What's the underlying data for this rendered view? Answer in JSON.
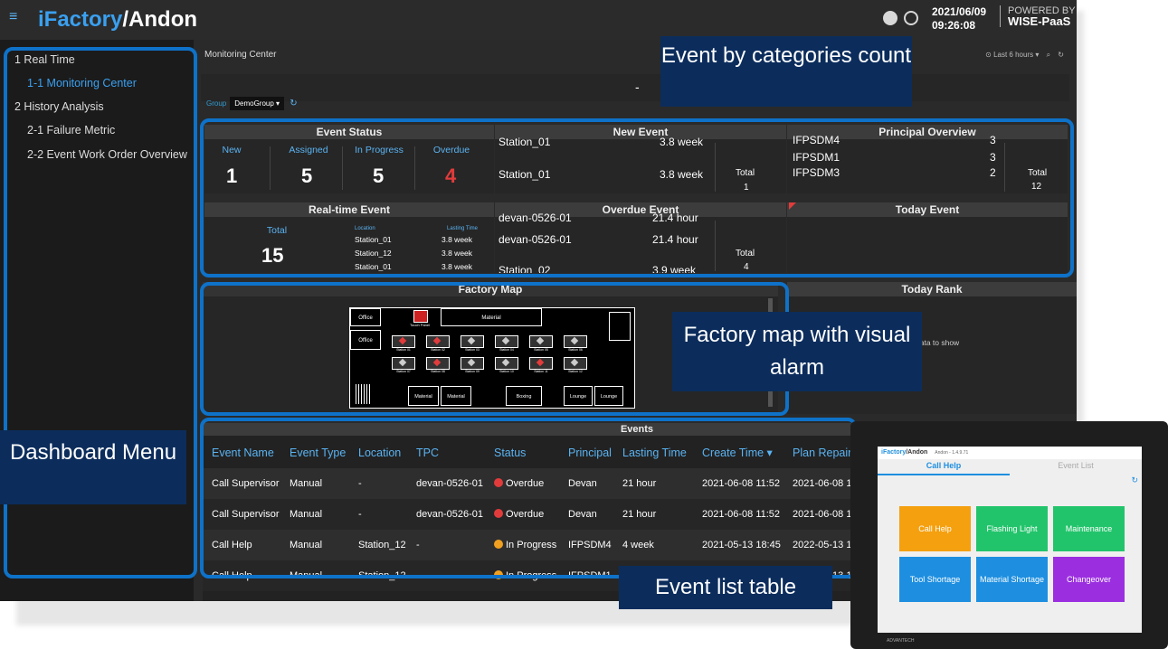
{
  "app": {
    "title_a": "iFactory",
    "title_b": "/Andon",
    "date": "2021/06/09",
    "time": "09:26:08",
    "powered_top": "POWERED BY",
    "powered_bottom": "WISE-PaaS"
  },
  "menu": [
    {
      "label": "1 Real Time"
    },
    {
      "label": "1-1 Monitoring Center",
      "active": true
    },
    {
      "label": "2 History Analysis"
    },
    {
      "label": "2-1 Failure Metric"
    },
    {
      "label": "2-2 Event Work Order Overview"
    }
  ],
  "breadcrumb": "Monitoring Center",
  "toolbar": {
    "time_range": "⊙ Last 6 hours ▾"
  },
  "banner_text": "-",
  "group": {
    "label": "Group",
    "value": "DemoGroup ▾"
  },
  "event_status": {
    "title": "Event Status",
    "items": [
      {
        "label": "New",
        "value": "1"
      },
      {
        "label": "Assigned",
        "value": "5"
      },
      {
        "label": "In Progress",
        "value": "5"
      },
      {
        "label": "Overdue",
        "value": "4"
      }
    ]
  },
  "new_event": {
    "title": "New Event",
    "rows": [
      {
        "name": "Station_01",
        "dur": "3.8 week"
      },
      {
        "name": "Station_01",
        "dur": "3.8 week"
      }
    ],
    "total_label": "Total",
    "total": "1"
  },
  "principal": {
    "title": "Principal Overview",
    "rows": [
      {
        "name": "IFPSDM4",
        "count": "3"
      },
      {
        "name": "IFPSDM1",
        "count": "3"
      },
      {
        "name": "IFPSDM3",
        "count": "2"
      }
    ],
    "total_label": "Total",
    "total": "12"
  },
  "realtime": {
    "title": "Real-time Event",
    "total_label": "Total",
    "total": "15",
    "col_location": "Location",
    "col_lasting": "Lasting Time",
    "rows": [
      {
        "loc": "Station_01",
        "t": "3.8 week"
      },
      {
        "loc": "Station_12",
        "t": "3.8 week"
      },
      {
        "loc": "Station_01",
        "t": "3.8 week"
      }
    ]
  },
  "overdue": {
    "title": "Overdue Event",
    "rows": [
      {
        "name": "devan-0526-01",
        "t": "21.4 hour"
      },
      {
        "name": "devan-0526-01",
        "t": "21.4 hour"
      },
      {
        "name": "Station_02",
        "t": "3.9 week"
      }
    ],
    "total_label": "Total",
    "total": "4"
  },
  "today_event": {
    "title": "Today Event"
  },
  "today_rank": {
    "title": "Today Rank",
    "empty": "data to show"
  },
  "factory_map": {
    "title": "Factory Map",
    "office": "Office",
    "material": "Material",
    "boxing": "Boxing",
    "lounge": "Lounge",
    "touch_panel": "Touch Panel",
    "stations_row1": [
      "Station 01",
      "Station 02",
      "Station 03",
      "Station 04",
      "Station 05",
      "Station 06"
    ],
    "stations_row2": [
      "Station 07",
      "Station 08",
      "Station 09",
      "Station 10",
      "Station 11",
      "Station 12"
    ]
  },
  "events": {
    "title": "Events",
    "headers": [
      "Event Name",
      "Event Type",
      "Location",
      "TPC",
      "Status",
      "Principal",
      "Lasting Time",
      "Create Time ▾",
      "Plan Repair"
    ],
    "rows": [
      [
        "Call Supervisor",
        "Manual",
        "-",
        "devan-0526-01",
        "Overdue",
        "Devan",
        "21 hour",
        "2021-06-08 11:52",
        "2021-06-08 1"
      ],
      [
        "Call Supervisor",
        "Manual",
        "-",
        "devan-0526-01",
        "Overdue",
        "Devan",
        "21 hour",
        "2021-06-08 11:52",
        "2021-06-08 1"
      ],
      [
        "Call Help",
        "Manual",
        "Station_12",
        "-",
        "In Progress",
        "IFPSDM4",
        "4 week",
        "2021-05-13 18:45",
        "2022-05-13 1"
      ],
      [
        "Call Help",
        "Manual",
        "Station_12",
        "-",
        "In Progress",
        "IFPSDM1",
        "",
        "",
        "2022-05-13 1"
      ]
    ]
  },
  "callouts": {
    "categories": "Event by categories count",
    "map": "Factory map with visual alarm",
    "menu": "Dashboard Menu",
    "table": "Event list table"
  },
  "tablet": {
    "title_a": "iFactory",
    "title_b": "/Andon",
    "version": "Andon - 1.4.9.71",
    "tabs": [
      "Call Help",
      "Event List"
    ],
    "tiles": [
      {
        "label": "Call Help",
        "color": "#f5a00f"
      },
      {
        "label": "Flashing Light",
        "color": "#22c46b"
      },
      {
        "label": "Maintenance",
        "color": "#22c46b"
      },
      {
        "label": "Tool Shortage",
        "color": "#1e8fe0"
      },
      {
        "label": "Material Shortage",
        "color": "#1e8fe0"
      },
      {
        "label": "Changeover",
        "color": "#9b2fe0"
      }
    ],
    "brand": "ADVANTECH"
  },
  "colors": {
    "accent": "#3aa0f0",
    "overdue": "#e23b3b",
    "in_progress": "#f0a020",
    "highlight": "#0e72c9",
    "callout": "#0c2d5c"
  }
}
